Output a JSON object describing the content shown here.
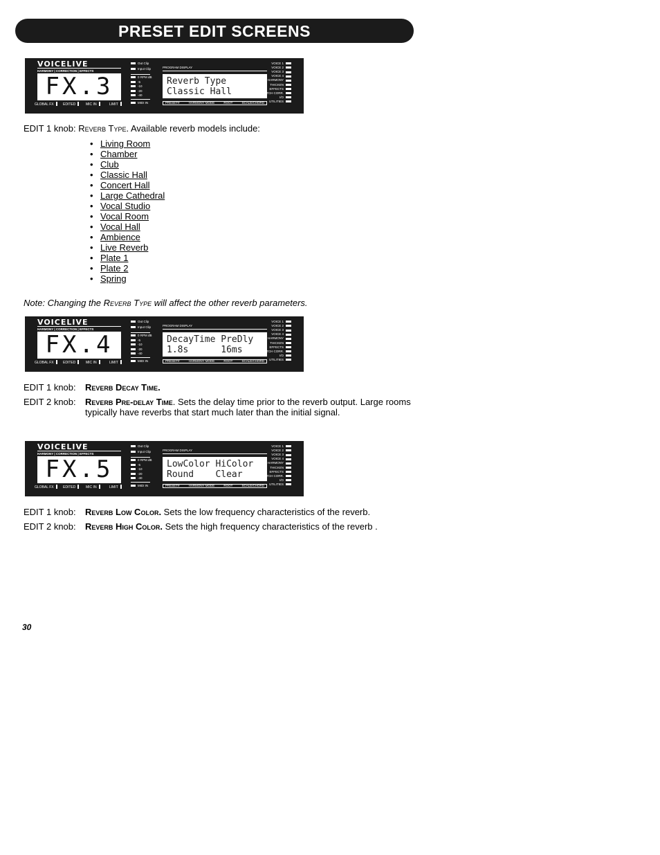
{
  "header": {
    "title": "PRESET EDIT SCREENS"
  },
  "panel_common": {
    "brand": "VOICELIVE",
    "brand_sub": "HARMONY | CORRECTION | EFFECTS",
    "bottom_labels": [
      "GLOBAL FX",
      "EDITED",
      "MIC IN",
      "LIMIT"
    ],
    "clip_labels": [
      "Out Clip",
      "Input Clip"
    ],
    "meter_labels": [
      "0   RPM dB",
      "-5",
      "-10",
      "-20",
      "-40"
    ],
    "midi_label": "MIDI IN",
    "program_display_label": "PROGRAM DISPLAY",
    "program_bar_labels": [
      "PRESET#",
      "HARMONY MODE",
      "ROOT",
      "SCALE/CHORD"
    ],
    "right_labels": [
      "VOICE 1",
      "VOICE 2",
      "VOICE 3",
      "VOICE 4",
      "HARMONY",
      "THICKEN",
      "EFFECTS",
      "PITCH CORR.",
      "I/O",
      "UTILITIES"
    ]
  },
  "panels": [
    {
      "big": "FX.3",
      "line1": "Reverb Type",
      "line2": "Classic Hall"
    },
    {
      "big": "FX.4",
      "line1": "DecayTime PreDly",
      "line2": "1.8s      16ms"
    },
    {
      "big": "FX.5",
      "line1": "LowColor HiColor",
      "line2": "Round    Clear"
    }
  ],
  "section1": {
    "edit1_prefix": "EDIT 1 knob: ",
    "edit1_param": "Reverb Type",
    "edit1_text": ".  Available reverb models include:",
    "models": [
      "Living Room",
      "Chamber",
      "Club",
      "Classic Hall",
      "Concert Hall",
      "Large Cathedral",
      "Vocal Studio",
      "Vocal Room",
      "Vocal Hall",
      "Ambience",
      "Live Reverb",
      "Plate 1",
      "Plate 2",
      "Spring"
    ],
    "note_prefix": "Note: Changing the ",
    "note_param": "Reverb Type",
    "note_suffix": " will affect the other reverb parameters."
  },
  "section2": {
    "edit1_prefix": "EDIT 1 knob:",
    "edit1_param": "Reverb Decay Time.",
    "edit2_prefix": "EDIT 2 knob:",
    "edit2_param": "Reverb Pre-delay Time",
    "edit2_text": ". Sets the delay time prior to the reverb output. Large rooms",
    "edit2_text2": "typically have reverbs that start much later than the initial signal."
  },
  "section3": {
    "edit1_prefix": "EDIT 1 knob:",
    "edit1_param": "Reverb Low Color.",
    "edit1_text": " Sets the low frequency characteristics of the reverb.",
    "edit2_prefix": "EDIT 2 knob:",
    "edit2_param": "Reverb High Color.",
    "edit2_text": " Sets the high frequency characteristics of the reverb ."
  },
  "footer": {
    "page_number": "30"
  }
}
